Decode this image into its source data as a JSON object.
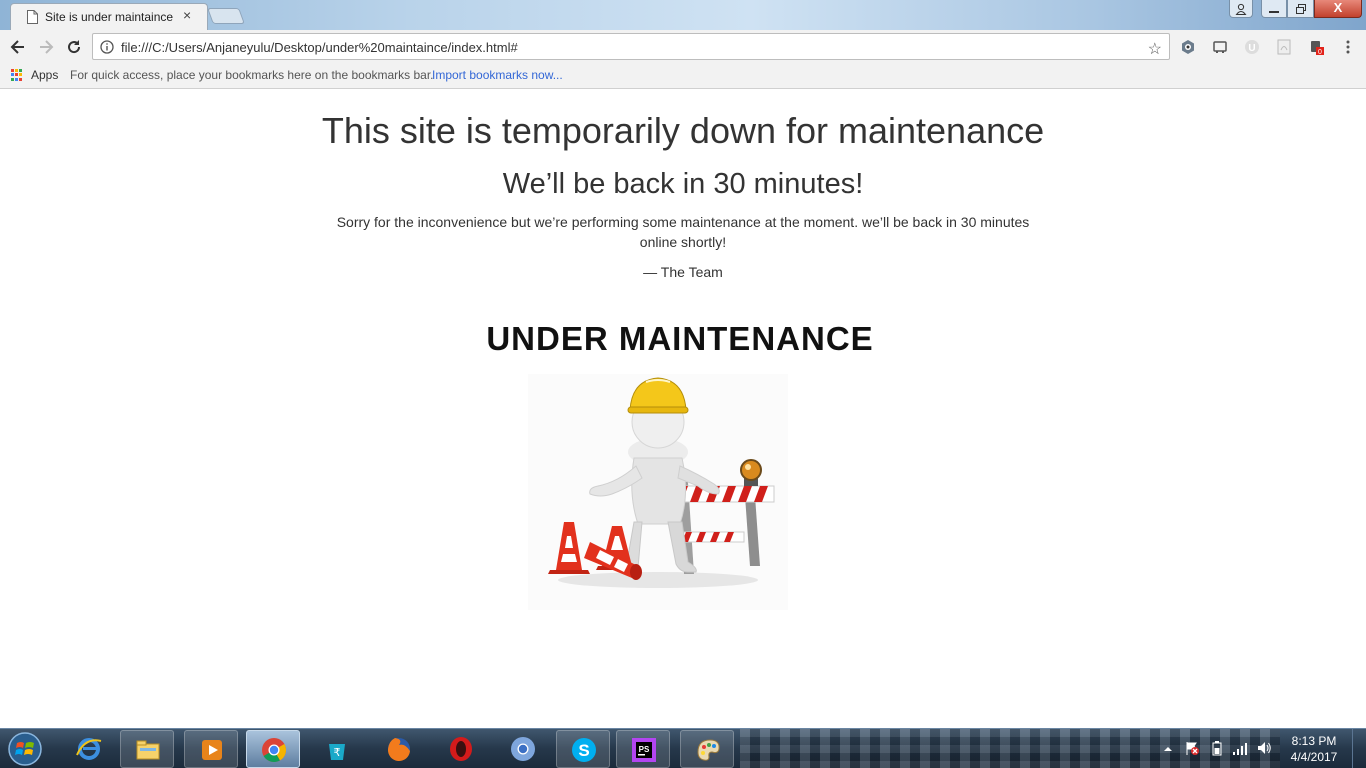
{
  "browser": {
    "tab_title": "Site is under maintaince",
    "tab_close_glyph": "×",
    "url": "file:///C:/Users/Anjaneyulu/Desktop/under%20maintaince/index.html#",
    "window_close_glyph": "X"
  },
  "bookmarks_bar": {
    "apps_label": "Apps",
    "hint": "For quick access, place your bookmarks here on the bookmarks bar.",
    "import_link": "Import bookmarks now..."
  },
  "page": {
    "heading": "This site is temporarily down for maintenance",
    "subheading": "We’ll be back in 30 minutes!",
    "message": "Sorry for the inconvenience but we’re performing some maintenance at the moment. we’ll be back in 30 minutes online shortly!",
    "signature": "— The Team",
    "banner_title": "UNDER MAINTENANCE"
  },
  "extensions": {
    "badge_count": "0"
  },
  "taskbar": {
    "apps": [
      "internet-explorer",
      "file-explorer",
      "media-player",
      "chrome",
      "shopping",
      "firefox",
      "opera",
      "chromium",
      "skype",
      "phpstorm",
      "paint"
    ],
    "active_app": "chrome",
    "time": "8:13 PM",
    "date": "4/4/2017"
  },
  "colors": {
    "link": "#3367d6",
    "close_button": "#c2412d",
    "taskbar": "#26384b"
  }
}
